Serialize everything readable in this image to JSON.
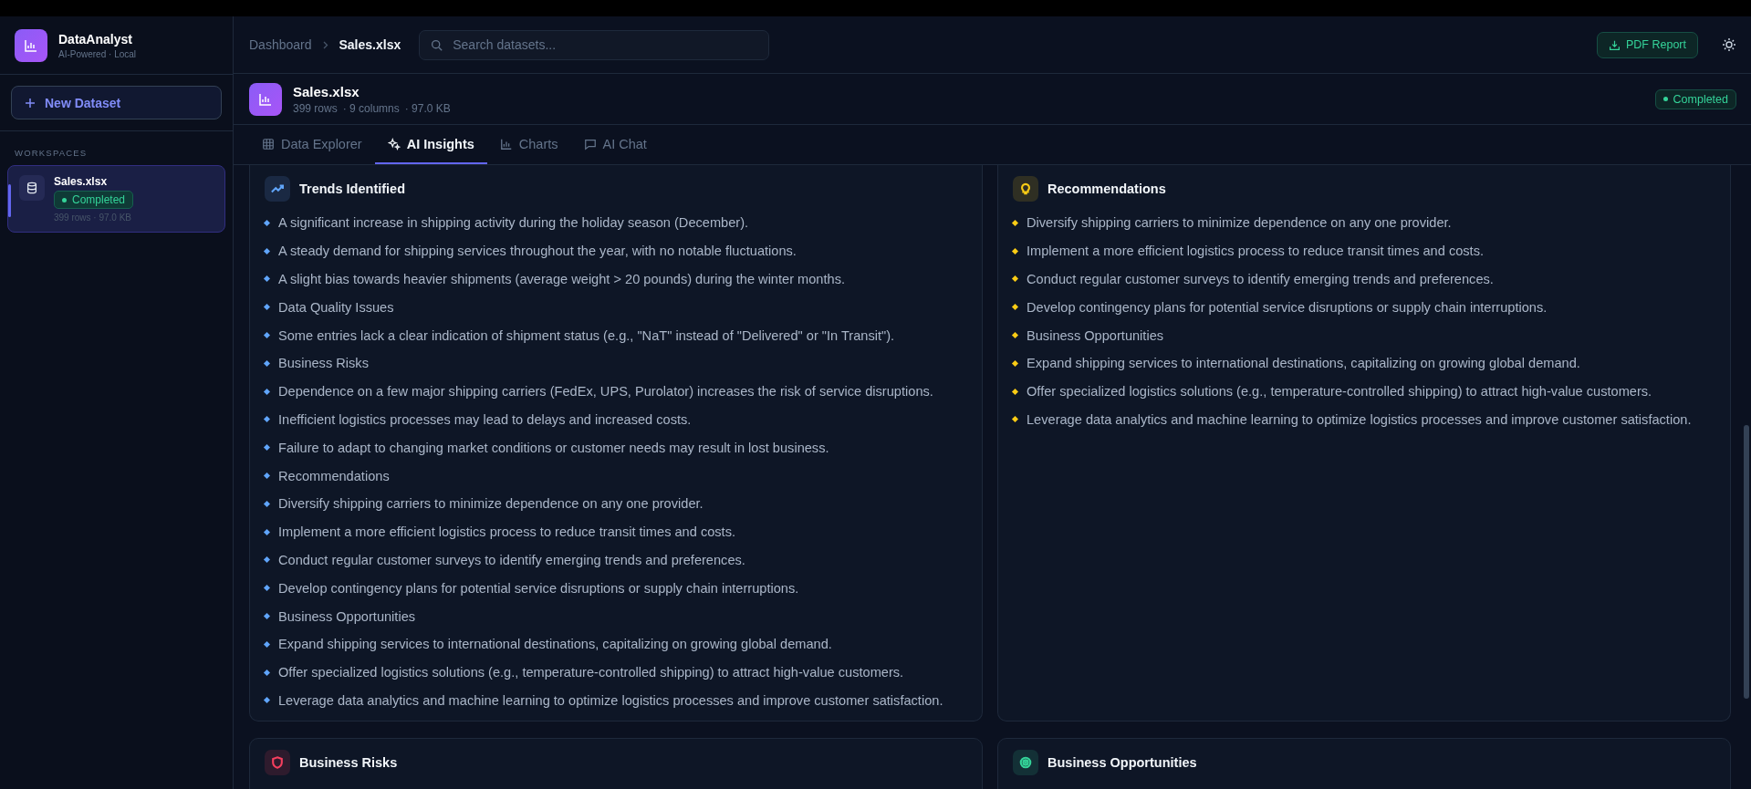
{
  "app": {
    "name": "DataAnalyst",
    "tagline": "AI-Powered · Local"
  },
  "sidebar": {
    "new_button": "New Dataset",
    "section_label": "WORKSPACES",
    "items": [
      {
        "name": "Sales.xlsx",
        "status": "Completed",
        "meta": "399 rows · 97.0 KB",
        "selected": true
      }
    ]
  },
  "header": {
    "breadcrumb": [
      "Dashboard",
      "Sales.xlsx"
    ],
    "search_placeholder": "Search datasets...",
    "report_button": "PDF Report"
  },
  "dataset": {
    "name": "Sales.xlsx",
    "meta": [
      "399 rows",
      "· 9 columns",
      "· 97.0 KB"
    ],
    "status": "Completed"
  },
  "tabs": [
    {
      "label": "Data Explorer",
      "kind": "table",
      "selected": false
    },
    {
      "label": "AI Insights",
      "kind": "sparkles",
      "selected": true
    },
    {
      "label": "Charts",
      "kind": "chart",
      "selected": false
    },
    {
      "label": "AI Chat",
      "kind": "chat",
      "selected": false
    }
  ],
  "cards": [
    {
      "title": "Trends Identified",
      "kind": "trend",
      "color": "#60a5fa",
      "items": [
        "A significant increase in shipping activity during the holiday season (December).",
        "A steady demand for shipping services throughout the year, with no notable fluctuations.",
        "A slight bias towards heavier shipments (average weight > 20 pounds) during the winter months.",
        "Data Quality Issues",
        "Some entries lack a clear indication of shipment status (e.g., \"NaT\" instead of \"Delivered\" or \"In Transit\").",
        "Business Risks",
        "Dependence on a few major shipping carriers (FedEx, UPS, Purolator) increases the risk of service disruptions.",
        "Inefficient logistics processes may lead to delays and increased costs.",
        "Failure to adapt to changing market conditions or customer needs may result in lost business.",
        "Recommendations",
        "Diversify shipping carriers to minimize dependence on any one provider.",
        "Implement a more efficient logistics process to reduce transit times and costs.",
        "Conduct regular customer surveys to identify emerging trends and preferences.",
        "Develop contingency plans for potential service disruptions or supply chain interruptions.",
        "Business Opportunities",
        "Expand shipping services to international destinations, capitalizing on growing global demand.",
        "Offer specialized logistics solutions (e.g., temperature-controlled shipping) to attract high-value customers.",
        "Leverage data analytics and machine learning to optimize logistics processes and improve customer satisfaction."
      ]
    },
    {
      "title": "Recommendations",
      "kind": "idea",
      "color": "#facc15",
      "items": [
        "Diversify shipping carriers to minimize dependence on any one provider.",
        "Implement a more efficient logistics process to reduce transit times and costs.",
        "Conduct regular customer surveys to identify emerging trends and preferences.",
        "Develop contingency plans for potential service disruptions or supply chain interruptions.",
        "Business Opportunities",
        "Expand shipping services to international destinations, capitalizing on growing global demand.",
        "Offer specialized logistics solutions (e.g., temperature-controlled shipping) to attract high-value customers.",
        "Leverage data analytics and machine learning to optimize logistics processes and improve customer satisfaction."
      ]
    },
    {
      "title": "Business Risks",
      "kind": "risk",
      "color": "#f43f5e"
    },
    {
      "title": "Business Opportunities",
      "kind": "opportunity",
      "color": "#34d399"
    }
  ]
}
